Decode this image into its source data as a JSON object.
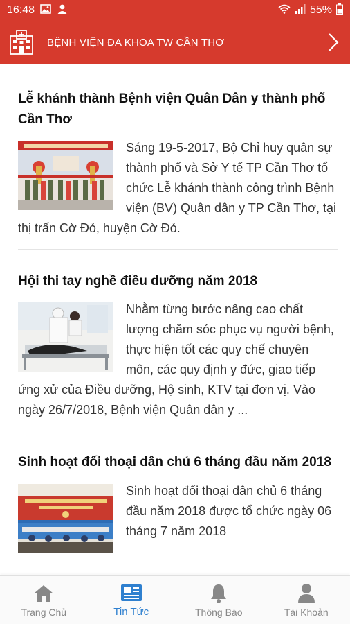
{
  "status_bar": {
    "time": "16:48",
    "battery": "55%",
    "icons": [
      "image-icon",
      "person-icon",
      "wifi-icon",
      "signal-icon",
      "battery-icon"
    ]
  },
  "header": {
    "title": "BỆNH VIỆN ĐA KHOA TW CẦN THƠ",
    "logo_icon": "hospital-building-icon",
    "next_icon": "chevron-right-icon"
  },
  "articles": [
    {
      "title": "Lễ khánh thành Bệnh viện Quân Dân y thành phố Cần Thơ",
      "summary": "Sáng 19-5-2017, Bộ Chỉ huy quân sự thành phố và Sở Y tế TP Cần Thơ tổ chức Lễ khánh thành công trình Bệnh viện (BV) Quân dân y TP Cần Thơ, tại thị trấn Cờ Đỏ, huyện Cờ Đỏ."
    },
    {
      "title": "Hội thi tay nghề điều dưỡng năm 2018",
      "summary": "Nhằm từng bước nâng cao chất lượng chăm sóc phục vụ người bệnh, thực hiện tốt các quy chế chuyên môn, các quy định y đức, giao tiếp ứng xử của Điều dưỡng, Hộ sinh, KTV tại đơn vị. Vào ngày 26/7/2018, Bệnh viện Quân dân y ..."
    },
    {
      "title": "Sinh hoạt đối thoại dân chủ 6 tháng đầu năm 2018",
      "summary": "Sinh hoạt đối thoại dân chủ 6 tháng đầu năm 2018 được tổ chức ngày 06 tháng 7 năm 2018"
    }
  ],
  "nav": {
    "items": [
      {
        "label": "Trang Chủ",
        "icon": "home-icon"
      },
      {
        "label": "Tin Tức",
        "icon": "newspaper-icon"
      },
      {
        "label": "Thông Báo",
        "icon": "bell-icon"
      },
      {
        "label": "Tài Khoản",
        "icon": "account-icon"
      }
    ],
    "active_index": 1
  },
  "colors": {
    "primary_red": "#d63a2d",
    "active_blue": "#2f80cf",
    "inactive_gray": "#888888"
  }
}
